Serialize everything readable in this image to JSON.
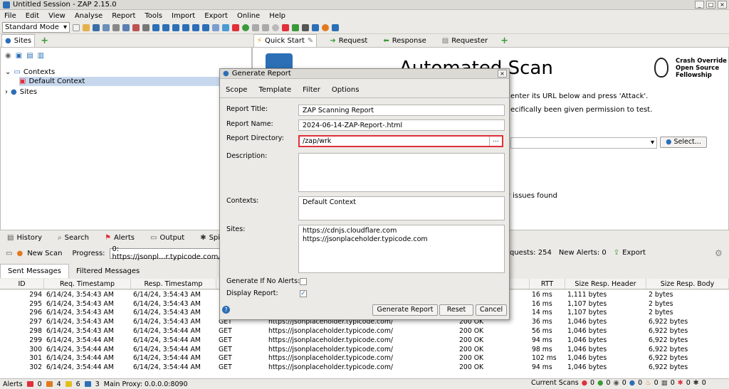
{
  "window": {
    "title": "Untitled Session - ZAP 2.15.0"
  },
  "menu": [
    "File",
    "Edit",
    "View",
    "Analyse",
    "Report",
    "Tools",
    "Import",
    "Export",
    "Online",
    "Help"
  ],
  "toolbar": {
    "mode": "Standard Mode"
  },
  "sites_panel": {
    "tab": "Sites",
    "tree": {
      "contexts": "Contexts",
      "default_context": "Default Context",
      "sites": "Sites"
    }
  },
  "work_tabs": [
    "Quick Start",
    "Request",
    "Response",
    "Requester"
  ],
  "quick_start": {
    "heading": "Automated Scan",
    "badge": [
      "Crash Override",
      "Open Source",
      "Fellowship"
    ],
    "line1": "enter its URL below and press 'Attack'.",
    "line2": "ecifically been given permission to test.",
    "select_button": "Select...",
    "issues_text": "y issues found"
  },
  "bottom_tabs": [
    "History",
    "Search",
    "Alerts",
    "Output",
    "Spider"
  ],
  "scan_bar": {
    "new_scan": "New Scan",
    "progress_label": "Progress:",
    "progress_value": "0: https://jsonpl...r.typicode.com/",
    "requests": "quests: 254",
    "new_alerts": "New Alerts: 0",
    "export": "Export"
  },
  "message_tabs": [
    "Sent Messages",
    "Filtered Messages"
  ],
  "columns": [
    "ID",
    "Req. Timestamp",
    "Resp. Timestamp",
    "",
    "",
    "n",
    "RTT",
    "Size Resp. Header",
    "Size Resp. Body"
  ],
  "rows": [
    [
      "294",
      "6/14/24, 3:54:43 AM",
      "6/14/24, 3:54:43 AM",
      "",
      "",
      "",
      "16 ms",
      "1,111 bytes",
      "2 bytes"
    ],
    [
      "295",
      "6/14/24, 3:54:43 AM",
      "6/14/24, 3:54:43 AM",
      "",
      "",
      "",
      "16 ms",
      "1,107 bytes",
      "2 bytes"
    ],
    [
      "296",
      "6/14/24, 3:54:43 AM",
      "6/14/24, 3:54:43 AM",
      "",
      "",
      "",
      "14 ms",
      "1,107 bytes",
      "2 bytes"
    ],
    [
      "297",
      "6/14/24, 3:54:43 AM",
      "6/14/24, 3:54:43 AM",
      "GET",
      "https://jsonplaceholder.typicode.com/",
      "200  OK",
      "36 ms",
      "1,046 bytes",
      "6,922 bytes"
    ],
    [
      "298",
      "6/14/24, 3:54:43 AM",
      "6/14/24, 3:54:44 AM",
      "GET",
      "https://jsonplaceholder.typicode.com/",
      "200  OK",
      "56 ms",
      "1,046 bytes",
      "6,922 bytes"
    ],
    [
      "299",
      "6/14/24, 3:54:44 AM",
      "6/14/24, 3:54:44 AM",
      "GET",
      "https://jsonplaceholder.typicode.com/",
      "200  OK",
      "94 ms",
      "1,046 bytes",
      "6,922 bytes"
    ],
    [
      "300",
      "6/14/24, 3:54:44 AM",
      "6/14/24, 3:54:44 AM",
      "GET",
      "https://jsonplaceholder.typicode.com/",
      "200  OK",
      "98 ms",
      "1,046 bytes",
      "6,922 bytes"
    ],
    [
      "301",
      "6/14/24, 3:54:44 AM",
      "6/14/24, 3:54:44 AM",
      "GET",
      "https://jsonplaceholder.typicode.com/",
      "200  OK",
      "102 ms",
      "1,046 bytes",
      "6,922 bytes"
    ],
    [
      "302",
      "6/14/24, 3:54:44 AM",
      "6/14/24, 3:54:44 AM",
      "GET",
      "https://jsonplaceholder.typicode.com/",
      "200  OK",
      "94 ms",
      "1,046 bytes",
      "6,922 bytes"
    ]
  ],
  "dialog": {
    "title": "Generate Report",
    "tabs": [
      "Scope",
      "Template",
      "Filter",
      "Options"
    ],
    "report_title_label": "Report Title:",
    "report_title": "ZAP Scanning Report",
    "report_name_label": "Report Name:",
    "report_name": "2024-06-14-ZAP-Report-.html",
    "report_dir_label": "Report Directory:",
    "report_dir": "/zap/wrk",
    "browse": "...",
    "description_label": "Description:",
    "contexts_label": "Contexts:",
    "contexts": "Default Context",
    "sites_label": "Sites:",
    "sites": [
      "https://cdnjs.cloudflare.com",
      "https://jsonplaceholder.typicode.com"
    ],
    "no_alerts_label": "Generate If No Alerts:",
    "display_label": "Display Report:",
    "buttons": {
      "generate": "Generate Report",
      "reset": "Reset",
      "cancel": "Cancel"
    }
  },
  "status": {
    "alerts": "Alerts",
    "a0": "0",
    "a1": "4",
    "a2": "6",
    "a3": "3",
    "proxy": "Main Proxy: 0.0.0.0:8090",
    "scans": "Current Scans",
    "s0": "0",
    "s1": "0",
    "s2": "0",
    "s3": "0",
    "s4": "0",
    "s5": "0",
    "s6": "0",
    "s7": "0"
  },
  "colors": {
    "accent": "#2c6fb6",
    "highlight": "#e0303a",
    "selection": "#c7d8ee"
  }
}
